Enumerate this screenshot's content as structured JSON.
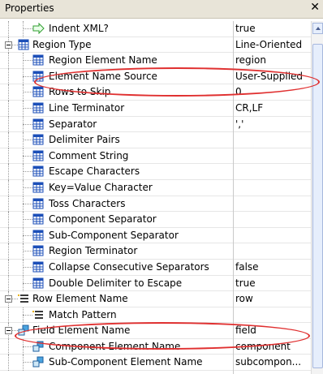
{
  "window": {
    "title": "Properties",
    "close_glyph": "✕"
  },
  "rows": [
    {
      "name": "Indent XML?",
      "value": "true",
      "icon": "arrow-right-icon",
      "level": 2
    },
    {
      "name": "Region Type",
      "value": "Line-Oriented",
      "icon": "table-icon",
      "level": 0,
      "expander": "minus"
    },
    {
      "name": "Region Element Name",
      "value": "region",
      "icon": "table-icon",
      "level": 1
    },
    {
      "name": "Element Name Source",
      "value": "User-Supplied",
      "icon": "table-icon",
      "level": 1
    },
    {
      "name": "Rows to Skip",
      "value": "0",
      "icon": "table-icon",
      "level": 1
    },
    {
      "name": "Line Terminator",
      "value": "CR,LF",
      "icon": "table-icon",
      "level": 1
    },
    {
      "name": "Separator",
      "value": "','",
      "icon": "table-icon",
      "level": 1
    },
    {
      "name": "Delimiter Pairs",
      "value": "",
      "icon": "table-icon",
      "level": 1
    },
    {
      "name": "Comment String",
      "value": "",
      "icon": "table-icon",
      "level": 1
    },
    {
      "name": "Escape Characters",
      "value": "",
      "icon": "table-icon",
      "level": 1
    },
    {
      "name": "Key=Value Character",
      "value": "",
      "icon": "table-icon",
      "level": 1
    },
    {
      "name": "Toss Characters",
      "value": "",
      "icon": "table-icon",
      "level": 1
    },
    {
      "name": "Component Separator",
      "value": "",
      "icon": "table-icon",
      "level": 1
    },
    {
      "name": "Sub-Component Separator",
      "value": "",
      "icon": "table-icon",
      "level": 1
    },
    {
      "name": "Region Terminator",
      "value": "",
      "icon": "table-icon",
      "level": 1
    },
    {
      "name": "Collapse Consecutive Separators",
      "value": "false",
      "icon": "table-icon",
      "level": 1
    },
    {
      "name": "Double Delimiter to Escape",
      "value": "true",
      "icon": "table-icon",
      "level": 1
    },
    {
      "name": "Row Element Name",
      "value": "row",
      "icon": "list-icon",
      "level": 0,
      "expander": "minus"
    },
    {
      "name": "Match Pattern",
      "value": "",
      "icon": "list-icon",
      "level": 1
    },
    {
      "name": "Field Element Name",
      "value": "field",
      "icon": "field-icon",
      "level": 0,
      "expander": "minus"
    },
    {
      "name": "Component Element Name",
      "value": "component",
      "icon": "field-icon",
      "level": 1
    },
    {
      "name": "Sub-Component Element Name",
      "value": "subcompon...",
      "icon": "field-icon",
      "level": 1
    }
  ],
  "colors": {
    "highlight": "#e03030",
    "tableIconBlue": "#1c4fb8",
    "arrowGreen": "#2f9e2f"
  }
}
